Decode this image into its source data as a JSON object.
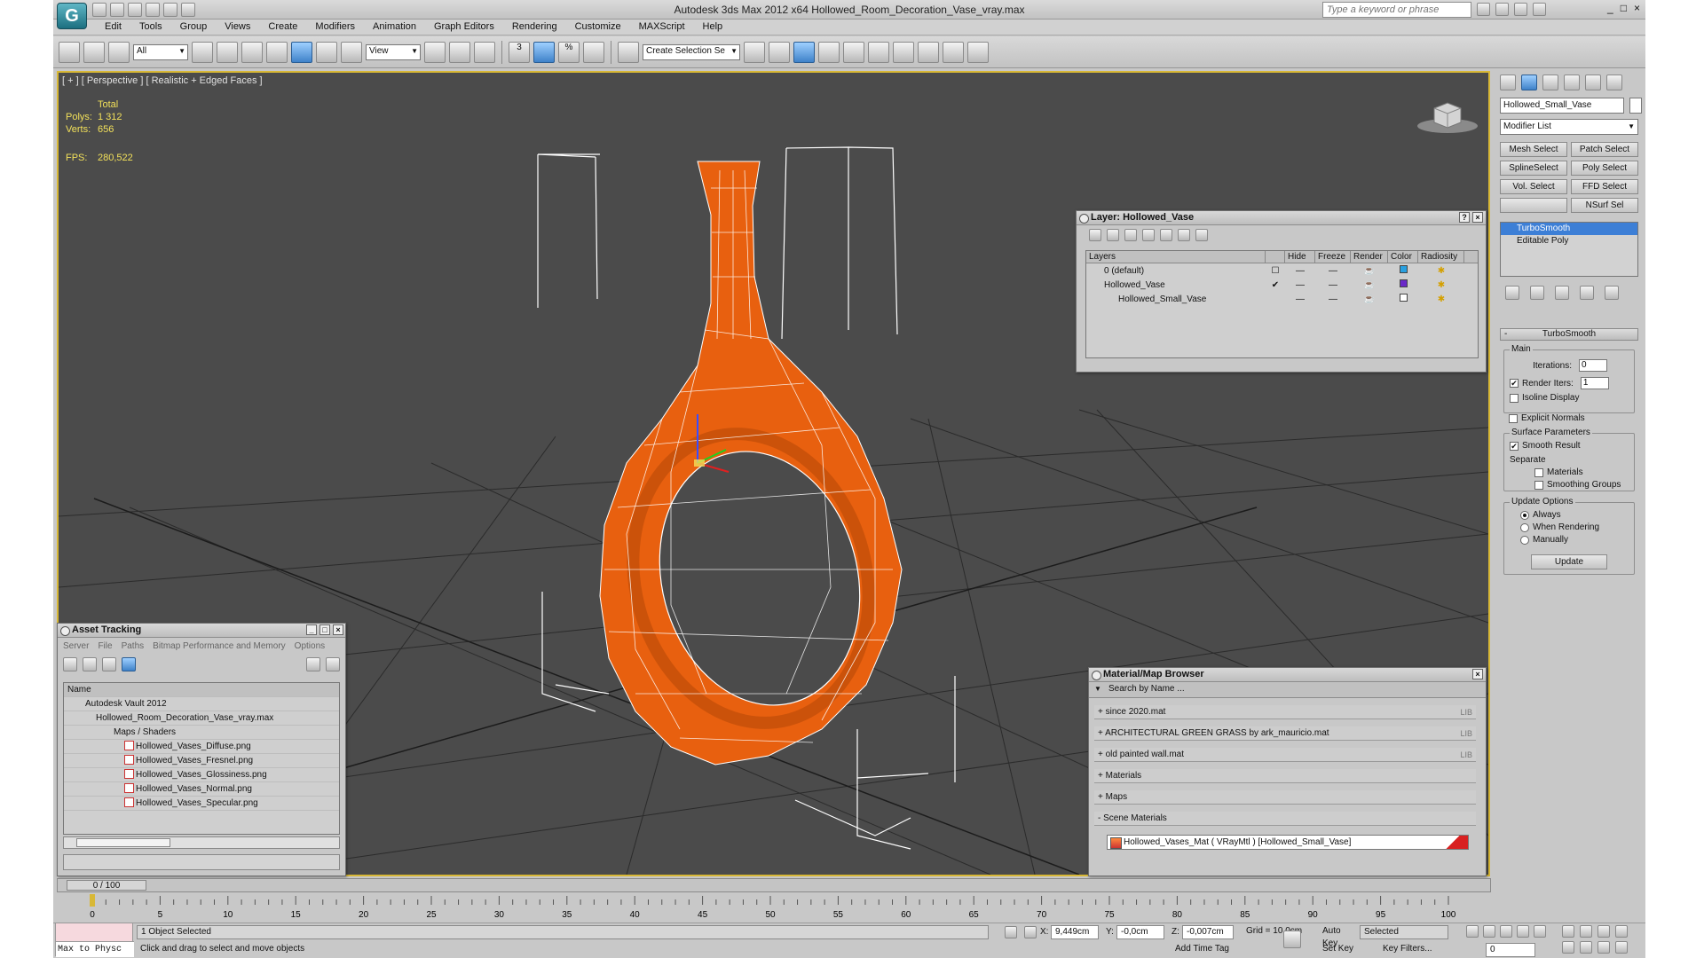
{
  "app": {
    "title": "Autodesk 3ds Max  2012 x64     Hollowed_Room_Decoration_Vase_vray.max",
    "logo": "3ds-max-logo",
    "search_placeholder": "Type a keyword or phrase",
    "window_controls": [
      "_",
      "□",
      "×"
    ]
  },
  "menu": [
    "Edit",
    "Tools",
    "Group",
    "Views",
    "Create",
    "Modifiers",
    "Animation",
    "Graph Editors",
    "Rendering",
    "Customize",
    "MAXScript",
    "Help"
  ],
  "toolbar": {
    "selection_filter": "All",
    "ref_coord": "View",
    "named_selection": "Create Selection Se",
    "snap_label": "3",
    "angle_snap_label": "%"
  },
  "viewport": {
    "label": "[ + ] [ Perspective ] [ Realistic + Edged Faces ]",
    "stats_header": "Total",
    "polys_label": "Polys:",
    "polys_value": "1 312",
    "verts_label": "Verts:",
    "verts_value": "656",
    "fps_label": "FPS:",
    "fps_value": "280,522",
    "object_color": "#e8600f",
    "grid_color": "#2b2b2b",
    "background": "#4b4b4b",
    "active_border": "#d8b836"
  },
  "layer_window": {
    "title": "Layer: Hollowed_Vase",
    "columns": [
      "Layers",
      "Hide",
      "Freeze",
      "Render",
      "Color",
      "Radiosity"
    ],
    "rows": [
      {
        "name": "0 (default)",
        "color": "#28a0e0",
        "current": false
      },
      {
        "name": "Hollowed_Vase",
        "color": "#6a28c8",
        "current": true
      },
      {
        "name": "Hollowed_Small_Vase",
        "color": "#ffffff",
        "current": false
      }
    ]
  },
  "command_panel": {
    "object_name": "Hollowed_Small_Vase",
    "modifier_list": "Modifier List",
    "modifier_buttons": [
      "Mesh Select",
      "Patch Select",
      "SplineSelect",
      "Poly Select",
      "Vol. Select",
      "FFD Select",
      "",
      "NSurf Sel"
    ],
    "stack": [
      {
        "label": "TurboSmooth",
        "selected": true
      },
      {
        "label": "Editable Poly",
        "selected": false
      }
    ],
    "turbosmooth": {
      "header": "TurboSmooth",
      "main_label": "Main",
      "iterations_label": "Iterations:",
      "iterations_value": "0",
      "render_iters_label": "Render Iters:",
      "render_iters_value": "1",
      "render_iters_checked": true,
      "isoline_label": "Isoline Display",
      "explicit_normals_label": "Explicit Normals",
      "surface_params_label": "Surface Parameters",
      "smooth_result_label": "Smooth Result",
      "separate_label": "Separate",
      "materials_label": "Materials",
      "smoothing_groups_label": "Smoothing Groups",
      "update_options_label": "Update Options",
      "always_label": "Always",
      "when_rendering_label": "When Rendering",
      "manually_label": "Manually",
      "update_button": "Update"
    }
  },
  "asset_tracking": {
    "title": "Asset Tracking",
    "menu": [
      "Server",
      "File",
      "Paths",
      "Bitmap Performance and Memory",
      "Options"
    ],
    "column": "Name",
    "rows": [
      {
        "label": "Autodesk Vault 2012",
        "indent": 0
      },
      {
        "label": "Hollowed_Room_Decoration_Vase_vray.max",
        "indent": 1
      },
      {
        "label": "Maps / Shaders",
        "indent": 2
      },
      {
        "label": "Hollowed_Vases_Diffuse.png",
        "indent": 3
      },
      {
        "label": "Hollowed_Vases_Fresnel.png",
        "indent": 3
      },
      {
        "label": "Hollowed_Vases_Glossiness.png",
        "indent": 3
      },
      {
        "label": "Hollowed_Vases_Normal.png",
        "indent": 3
      },
      {
        "label": "Hollowed_Vases_Specular.png",
        "indent": 3
      }
    ]
  },
  "material_browser": {
    "title": "Material/Map Browser",
    "search_placeholder": "Search by Name ...",
    "groups": [
      {
        "label": "+ since 2020.mat",
        "lib": "LIB"
      },
      {
        "label": "+ ARCHITECTURAL GREEN GRASS by ark_mauricio.mat",
        "lib": "LIB"
      },
      {
        "label": "+ old painted wall.mat",
        "lib": "LIB"
      },
      {
        "label": "+ Materials",
        "lib": ""
      },
      {
        "label": "+ Maps",
        "lib": ""
      },
      {
        "label": "- Scene Materials",
        "lib": ""
      }
    ],
    "scene_material": "Hollowed_Vases_Mat ( VRayMtl ) [Hollowed_Small_Vase]"
  },
  "timeline": {
    "frame_display": "0 / 100",
    "ticks": [
      "0",
      "5",
      "10",
      "15",
      "20",
      "25",
      "30",
      "35",
      "40",
      "45",
      "50",
      "55",
      "60",
      "65",
      "70",
      "75",
      "80",
      "85",
      "90",
      "95",
      "100"
    ]
  },
  "status": {
    "maxscript": "Max to Physc",
    "selection": "1 Object Selected",
    "prompt": "Click and drag to select and move objects",
    "x_label": "X:",
    "x_value": "9,449cm",
    "y_label": "Y:",
    "y_value": "-0,0cm",
    "z_label": "Z:",
    "z_value": "-0,007cm",
    "grid": "Grid = 10,0cm",
    "auto_key": "Auto Key",
    "set_key": "Set Key",
    "selected_dd": "Selected",
    "key_filters": "Key Filters...",
    "add_time_tag": "Add Time Tag",
    "frame": "0"
  }
}
